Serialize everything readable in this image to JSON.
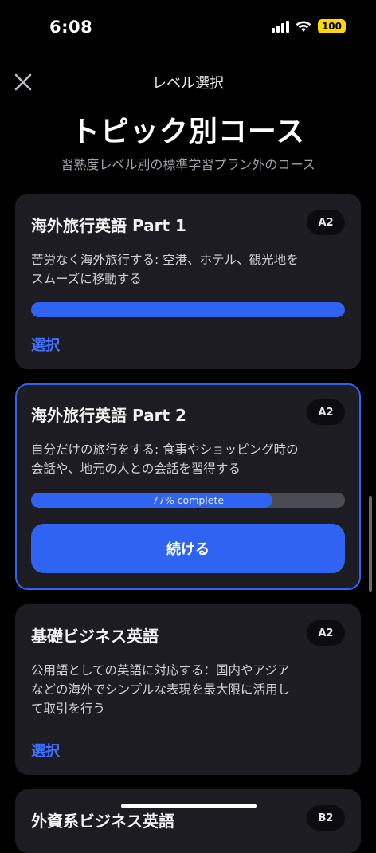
{
  "status_bar": {
    "time": "6:08",
    "battery": "100"
  },
  "header": {
    "title": "レベル選択"
  },
  "page": {
    "title": "トピック別コース",
    "subtitle": "習熟度レベル別の標準学習プラン外のコース"
  },
  "courses": [
    {
      "title": "海外旅行英語 Part 1",
      "level": "A2",
      "desc_lines": [
        "苦労なく海外旅行する: 空港、ホテル、観光地を",
        "スムーズに移動する"
      ],
      "progress": 1.0,
      "action": "選択"
    },
    {
      "title": "海外旅行英語 Part 2",
      "level": "A2",
      "desc_lines": [
        "自分だけの旅行をする: 食事やショッピング時の",
        "会話や、地元の人との会話を習得する"
      ],
      "progress": 0.77,
      "progress_label": "77% complete",
      "action": "続ける"
    },
    {
      "title": "基礎ビジネス英語",
      "level": "A2",
      "desc_lines": [
        "公用語としての英語に対応する：国内やアジア",
        "などの海外でシンプルな表現を最大限に活用し",
        "て取引を行う"
      ],
      "action": "選択"
    },
    {
      "title": "外資系ビジネス英語",
      "level": "B2"
    }
  ],
  "colors": {
    "accent": "#2f63f2",
    "link": "#3f72ff",
    "card_bg": "#1c1c22"
  }
}
